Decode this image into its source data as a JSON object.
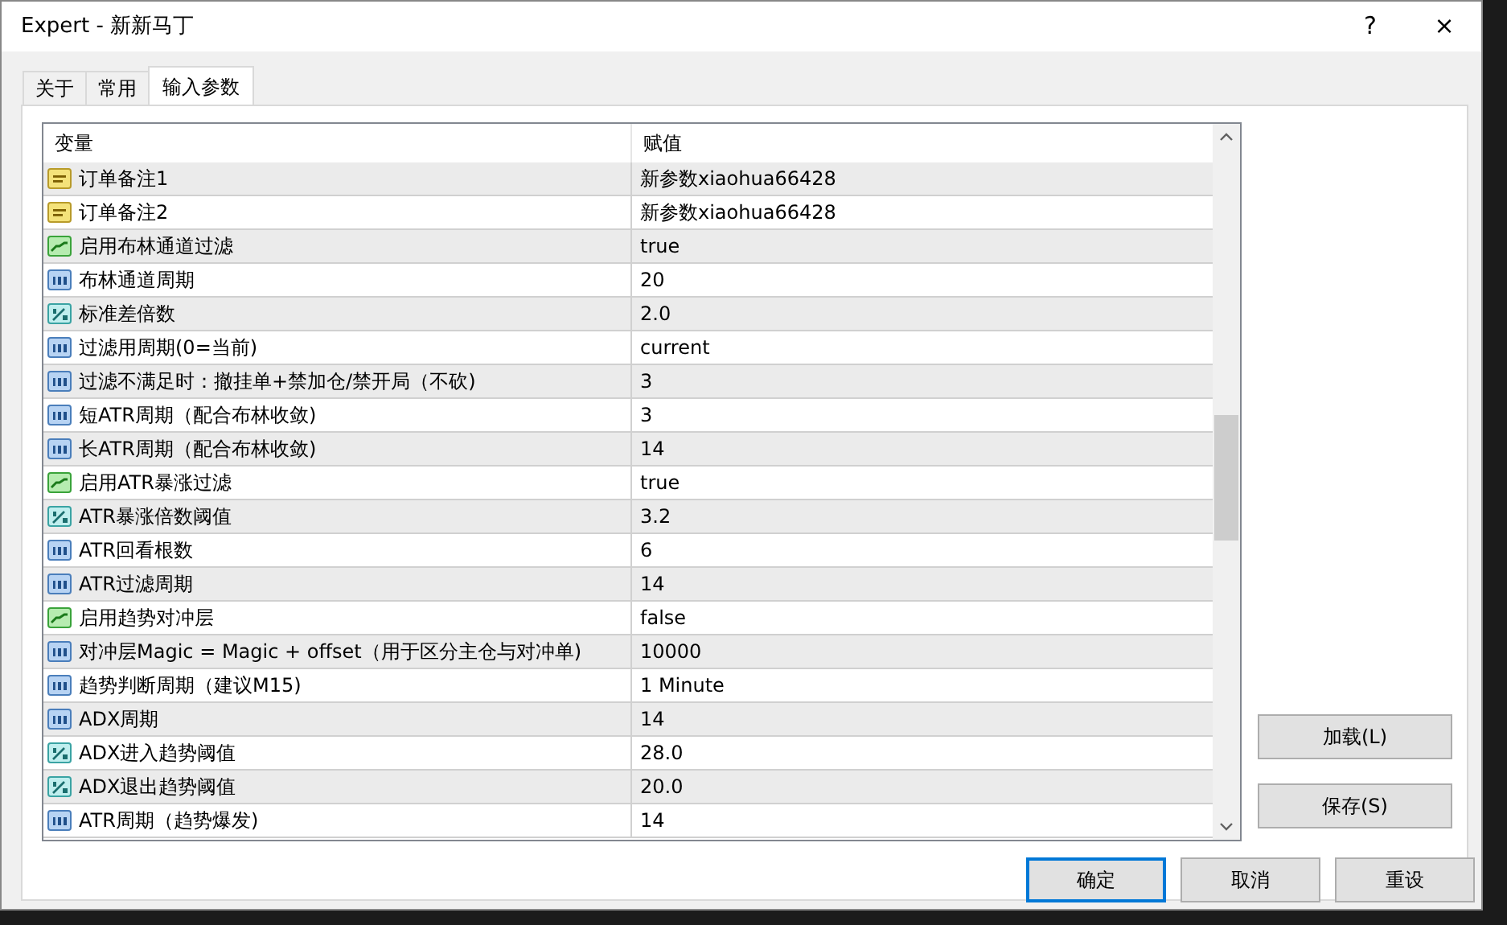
{
  "window": {
    "title": "Expert - 新新马丁",
    "help": "?",
    "close": "×"
  },
  "tabs": [
    {
      "label": "关于",
      "selected": false
    },
    {
      "label": "常用",
      "selected": false
    },
    {
      "label": "输入参数",
      "selected": true
    }
  ],
  "table": {
    "columns": [
      "变量",
      "赋值"
    ],
    "rows": [
      {
        "kind": "string",
        "name": "订单备注1",
        "value": "新参数xiaohua66428"
      },
      {
        "kind": "string",
        "name": "订单备注2",
        "value": "新参数xiaohua66428"
      },
      {
        "kind": "bool",
        "name": "启用布林通道过滤",
        "value": "true"
      },
      {
        "kind": "int",
        "name": "布林通道周期",
        "value": "20"
      },
      {
        "kind": "double",
        "name": "标准差倍数",
        "value": "2.0"
      },
      {
        "kind": "int",
        "name": "过滤用周期(0=当前)",
        "value": "current"
      },
      {
        "kind": "int",
        "name": "过滤不满足时：撤挂单+禁加仓/禁开局（不砍)",
        "value": "3"
      },
      {
        "kind": "int",
        "name": "短ATR周期（配合布林收敛)",
        "value": "3"
      },
      {
        "kind": "int",
        "name": "长ATR周期（配合布林收敛)",
        "value": "14"
      },
      {
        "kind": "bool",
        "name": "启用ATR暴涨过滤",
        "value": "true"
      },
      {
        "kind": "double",
        "name": "ATR暴涨倍数阈值",
        "value": "3.2"
      },
      {
        "kind": "int",
        "name": "ATR回看根数",
        "value": "6"
      },
      {
        "kind": "int",
        "name": "ATR过滤周期",
        "value": "14"
      },
      {
        "kind": "bool",
        "name": "启用趋势对冲层",
        "value": "false"
      },
      {
        "kind": "int",
        "name": "对冲层Magic = Magic + offset（用于区分主仓与对冲单)",
        "value": "10000"
      },
      {
        "kind": "int",
        "name": "趋势判断周期（建议M15)",
        "value": "1 Minute"
      },
      {
        "kind": "int",
        "name": "ADX周期",
        "value": "14"
      },
      {
        "kind": "double",
        "name": "ADX进入趋势阈值",
        "value": "28.0"
      },
      {
        "kind": "double",
        "name": "ADX退出趋势阈值",
        "value": "20.0"
      },
      {
        "kind": "int",
        "name": "ATR周期（趋势爆发)",
        "value": "14"
      }
    ]
  },
  "side_buttons": [
    "加载(L)",
    "保存(S)"
  ],
  "buttons": [
    {
      "label": "确定",
      "default": true
    },
    {
      "label": "取消",
      "default": false
    },
    {
      "label": "重设",
      "default": false
    }
  ]
}
